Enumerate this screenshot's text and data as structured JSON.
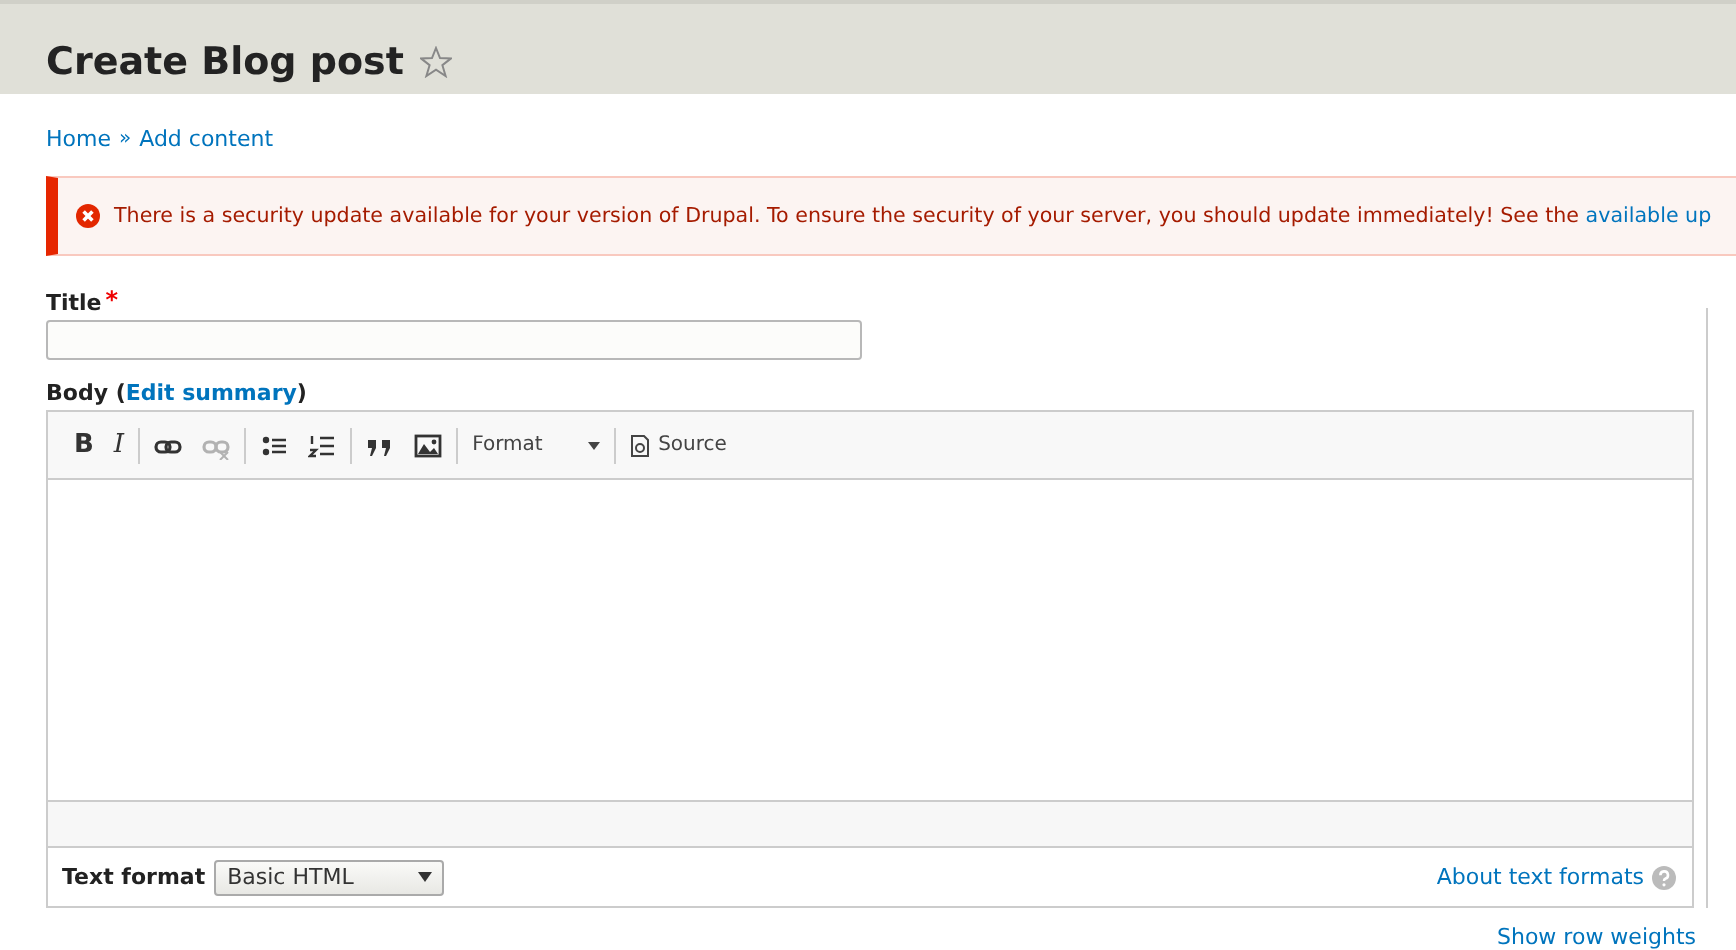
{
  "page": {
    "title": "Create Blog post",
    "favorite": false
  },
  "breadcrumb": {
    "items": [
      "Home",
      "Add content"
    ],
    "separator": "»"
  },
  "message": {
    "text": "There is a security update available for your version of Drupal. To ensure the security of your server, you should update immediately! See the ",
    "link": "available up"
  },
  "title_field": {
    "label": "Title",
    "required": true,
    "required_mark": "*"
  },
  "body": {
    "label": "Body (",
    "summary_link": "Edit summary",
    "label_end": ")",
    "toolbar": [
      [
        {
          "kind": "bold",
          "label": "B",
          "disabled": false
        },
        {
          "kind": "italic",
          "label": "I",
          "disabled": false
        }
      ],
      [
        {
          "kind": "link",
          "disabled": false
        },
        {
          "kind": "unlink",
          "disabled": true
        }
      ],
      [
        {
          "kind": "bulleted-list",
          "disabled": false
        },
        {
          "kind": "numbered-list",
          "disabled": false
        }
      ],
      [
        {
          "kind": "blockquote",
          "disabled": false
        },
        {
          "kind": "image",
          "disabled": false
        }
      ],
      [
        {
          "kind": "format-menu",
          "label": "Format",
          "disabled": false
        }
      ],
      [
        {
          "kind": "source",
          "label": "Source",
          "disabled": false
        }
      ]
    ],
    "text_format": {
      "label": "Text format",
      "value": "Basic HTML"
    },
    "about_link": "About text formats"
  },
  "show_row_weights": "Show row weights"
}
